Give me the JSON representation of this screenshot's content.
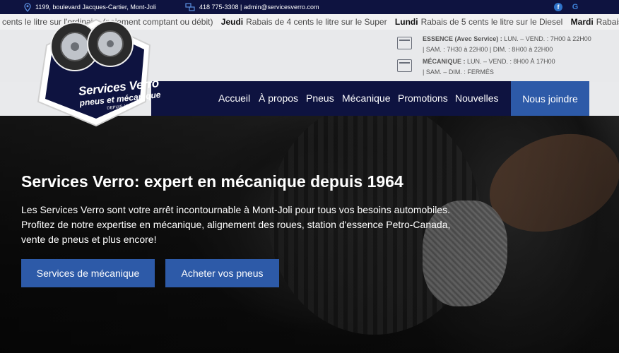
{
  "topbar": {
    "address": "1199, boulevard Jacques-Cartier, Mont-Joli",
    "contact": "418 775-3308 | admin@servicesverro.com",
    "facebook_glyph": "f",
    "google_glyph": "G"
  },
  "ticker": {
    "items": [
      {
        "day": "",
        "text": "cents le litre sur l'ordinaire (paiement comptant ou débit)"
      },
      {
        "day": "Jeudi",
        "text": "Rabais de 4 cents le litre sur le Super"
      },
      {
        "day": "Lundi",
        "text": "Rabais de 5 cents le litre sur le Diesel"
      },
      {
        "day": "Mardi",
        "text": "Rabais de"
      }
    ]
  },
  "logo": {
    "line1": "Services Verro",
    "line2": "pneus et mécanique",
    "line3": "DEPUIS 1964"
  },
  "hours": {
    "essence": {
      "label": "ESSENCE (Avec Service) :",
      "line1": "LUN. – VEND. : 7H00 à 22H00",
      "line2": "| SAM. : 7H30 à 22H00 | DIM. : 8H00 à 22H00"
    },
    "mecanique": {
      "label": "MÉCANIQUE :",
      "line1": "LUN. – VEND. : 8H00 À 17H00",
      "line2": "| SAM. – DIM. : FERMÉS"
    }
  },
  "nav": {
    "items": [
      "Accueil",
      "À propos",
      "Pneus",
      "Mécanique",
      "Promotions",
      "Nouvelles"
    ],
    "cta": "Nous joindre"
  },
  "hero": {
    "title": "Services Verro: expert en mécanique depuis 1964",
    "text": "Les Services Verro sont votre arrêt incontournable à Mont-Joli pour tous vos besoins automobiles. Profitez de notre expertise en mécanique, alignement des roues, station d'essence Petro-Canada, vente de pneus et plus encore!",
    "btn1": "Services de mécanique",
    "btn2": "Acheter vos pneus"
  },
  "colors": {
    "navy": "#0e1340",
    "accent": "#2d5aa8"
  }
}
